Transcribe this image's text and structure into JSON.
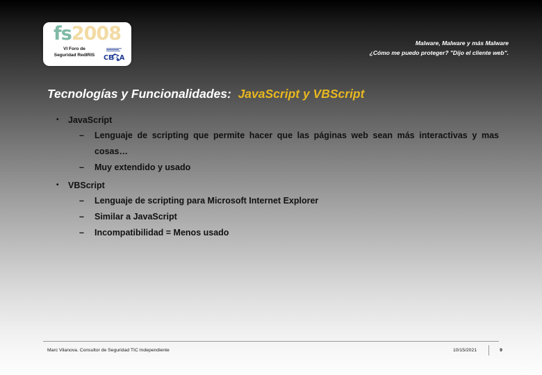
{
  "slide": {
    "background_top_color": "#000000",
    "background_bottom_color": "#fdfdfd"
  },
  "logo": {
    "wordmark_fs": "fs",
    "wordmark_year": "2008",
    "fs_color": "#7fb9a6",
    "year_color": "#f2dba4",
    "subtitle_line1": "VI Foro de",
    "subtitle_line2": "Seguridad RedIRIS",
    "partner_name": "CESCA",
    "partner_color": "#1f3a93"
  },
  "header": {
    "line1": "Malware, Malware y más Malware",
    "line2": "¿Cómo me puedo proteger? \"Dijo el cliente web\"."
  },
  "title": {
    "main": "Tecnologías y Funcionalidades:",
    "accent": "JavaScript y VBScript",
    "accent_color": "#e9b81f",
    "main_color": "#ffffff"
  },
  "body": {
    "bullet_marker": "•",
    "dash_marker": "–",
    "groups": [
      {
        "heading": "JavaScript",
        "items": [
          "Lenguaje de scripting que permite hacer que las páginas web sean más interactivas y mas cosas…",
          "Muy extendido y usado"
        ]
      },
      {
        "heading": "VBScript",
        "items": [
          "Lenguaje de scripting para Microsoft Internet Explorer",
          "Similar a JavaScript",
          "Incompatibilidad = Menos usado"
        ]
      }
    ]
  },
  "footer": {
    "author": "Marc Vilanova. Consultor de Seguridad TIC Independiente",
    "date": "10/15/2021",
    "page_number": "9"
  }
}
